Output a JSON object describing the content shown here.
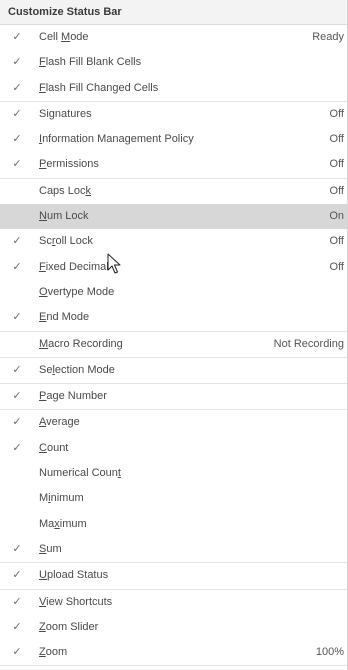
{
  "menu": {
    "title": "Customize Status Bar",
    "check_glyph": "✓",
    "pointer_icon": "arrow-cursor-icon",
    "groups": [
      [
        {
          "name": "cell-mode",
          "label": "Cell Mode",
          "access": "M",
          "checked": true,
          "value": "Ready"
        },
        {
          "name": "flash-fill-blank-cells",
          "label": "Flash Fill Blank Cells",
          "access": "F",
          "checked": true,
          "value": ""
        },
        {
          "name": "flash-fill-changed-cells",
          "label": "Flash Fill Changed Cells",
          "access": "F",
          "checked": true,
          "value": ""
        }
      ],
      [
        {
          "name": "signatures",
          "label": "Signatures",
          "access": "g",
          "checked": true,
          "value": "Off"
        },
        {
          "name": "information-management-policy",
          "label": "Information Management Policy",
          "access": "I",
          "checked": true,
          "value": "Off"
        },
        {
          "name": "permissions",
          "label": "Permissions",
          "access": "P",
          "checked": true,
          "value": "Off"
        }
      ],
      [
        {
          "name": "caps-lock",
          "label": "Caps Lock",
          "access": "k",
          "checked": false,
          "value": "Off"
        },
        {
          "name": "num-lock",
          "label": "Num Lock",
          "access": "N",
          "checked": false,
          "value": "On",
          "hover": true
        },
        {
          "name": "scroll-lock",
          "label": "Scroll Lock",
          "access": "r",
          "checked": true,
          "value": "Off"
        },
        {
          "name": "fixed-decimal",
          "label": "Fixed Decimal",
          "access": "F",
          "checked": true,
          "value": "Off"
        },
        {
          "name": "overtype-mode",
          "label": "Overtype Mode",
          "access": "O",
          "checked": false,
          "value": ""
        },
        {
          "name": "end-mode",
          "label": "End Mode",
          "access": "E",
          "checked": true,
          "value": ""
        }
      ],
      [
        {
          "name": "macro-recording",
          "label": "Macro Recording",
          "access": "M",
          "checked": false,
          "value": "Not Recording"
        }
      ],
      [
        {
          "name": "selection-mode",
          "label": "Selection Mode",
          "access": "l",
          "checked": true,
          "value": ""
        }
      ],
      [
        {
          "name": "page-number",
          "label": "Page Number",
          "access": "P",
          "checked": true,
          "value": ""
        }
      ],
      [
        {
          "name": "average",
          "label": "Average",
          "access": "A",
          "checked": true,
          "value": ""
        },
        {
          "name": "count",
          "label": "Count",
          "access": "C",
          "checked": true,
          "value": ""
        },
        {
          "name": "numerical-count",
          "label": "Numerical Count",
          "access": "t",
          "checked": false,
          "value": ""
        },
        {
          "name": "minimum",
          "label": "Minimum",
          "access": "i",
          "checked": false,
          "value": ""
        },
        {
          "name": "maximum",
          "label": "Maximum",
          "access": "x",
          "checked": false,
          "value": ""
        },
        {
          "name": "sum",
          "label": "Sum",
          "access": "S",
          "checked": true,
          "value": ""
        }
      ],
      [
        {
          "name": "upload-status",
          "label": "Upload Status",
          "access": "U",
          "checked": true,
          "value": ""
        }
      ],
      [
        {
          "name": "view-shortcuts",
          "label": "View Shortcuts",
          "access": "V",
          "checked": true,
          "value": ""
        },
        {
          "name": "zoom-slider",
          "label": "Zoom Slider",
          "access": "Z",
          "checked": true,
          "value": ""
        },
        {
          "name": "zoom",
          "label": "Zoom",
          "access": "Z",
          "checked": true,
          "value": "100%"
        }
      ]
    ]
  }
}
